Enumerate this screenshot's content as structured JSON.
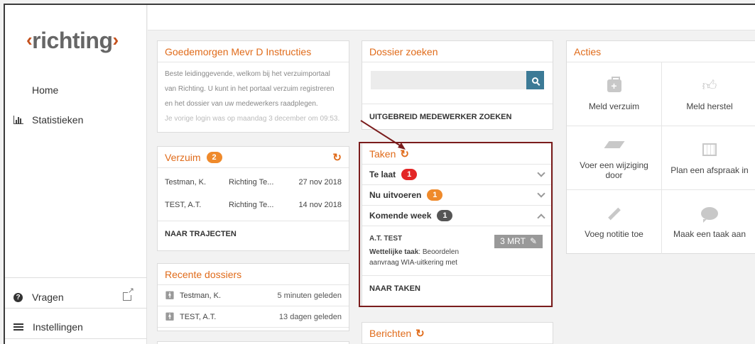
{
  "brand": {
    "logo_text": "richting",
    "accent": "#e06b1a"
  },
  "sidebar": {
    "home": "Home",
    "statistieken": "Statistieken",
    "vragen": "Vragen",
    "instellingen": "Instellingen"
  },
  "intro": {
    "title": "Goedemorgen Mevr D Instructies",
    "line1": "Beste leidinggevende, welkom bij het verzuimportaal",
    "line2": "van Richting. U kunt in het portaal verzuim registreren",
    "line3": "en het dossier van uw medewerkers raadplegen.",
    "last_login": "Je vorige login was op maandag 3 december om 09:53."
  },
  "verzuim": {
    "title": "Verzuim",
    "count": "2",
    "rows": [
      {
        "name": "Testman, K.",
        "org": "Richting Te...",
        "date": "27 nov 2018"
      },
      {
        "name": "TEST, A.T.",
        "org": "Richting Te...",
        "date": "14 nov 2018"
      }
    ],
    "link": "NAAR TRAJECTEN"
  },
  "recente": {
    "title": "Recente dossiers",
    "rows": [
      {
        "name": "Testman, K.",
        "when": "5 minuten geleden"
      },
      {
        "name": "TEST, A.T.",
        "when": "13 dagen geleden"
      }
    ]
  },
  "dossier": {
    "title": "Dossier zoeken",
    "search_placeholder": "",
    "link": "UITGEBREID MEDEWERKER ZOEKEN"
  },
  "taken": {
    "title": "Taken",
    "te_laat": {
      "label": "Te laat",
      "count": "1"
    },
    "nu_uitvoeren": {
      "label": "Nu uitvoeren",
      "count": "1"
    },
    "komende_week": {
      "label": "Komende week",
      "count": "1"
    },
    "task": {
      "name": "A.T. TEST",
      "date": "3 MRT",
      "type_label": "Wettelijke taak",
      "desc_1": ": Beoordelen",
      "desc_2": "aanvraag WIA-uitkering met"
    },
    "link": "NAAR TAKEN"
  },
  "berichten": {
    "title": "Berichten"
  },
  "acties": {
    "title": "Acties",
    "items": [
      {
        "label": "Meld verzuim",
        "icon": "medical-kit-icon"
      },
      {
        "label": "Meld herstel",
        "icon": "thumbs-up-icon"
      },
      {
        "label": "Voer een wijziging door",
        "icon": "eraser-icon"
      },
      {
        "label": "Plan een afspraak in",
        "icon": "calendar-icon"
      },
      {
        "label": "Voeg notitie toe",
        "icon": "pencil-icon"
      },
      {
        "label": "Maak een taak aan",
        "icon": "speech-bubble-icon"
      }
    ]
  }
}
